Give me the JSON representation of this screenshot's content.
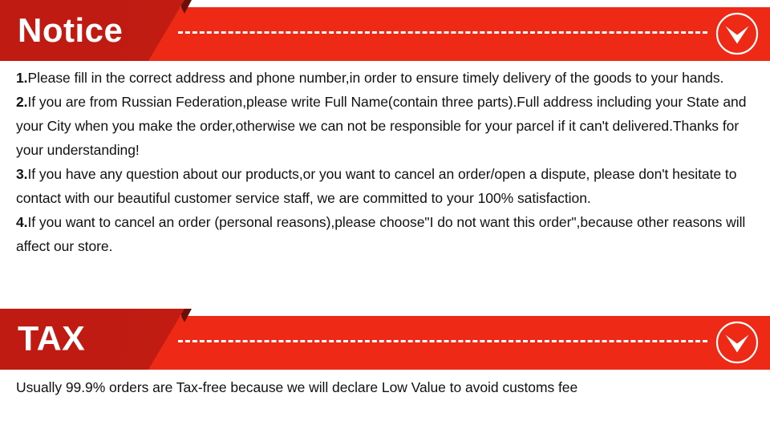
{
  "sections": [
    {
      "id": "notice",
      "title": "Notice",
      "icon": "chevron-down-circle-icon",
      "paragraphs": [
        {
          "number": "1.",
          "text": "Please fill in the correct address and phone number,in order to ensure timely delivery of the goods to your hands."
        },
        {
          "number": "2.",
          "text": "If you are from Russian Federation,please write Full Name(contain three parts).Full address including your State and your City when you make the order,otherwise we can not be responsible for your parcel if it can't delivered.Thanks for your understanding!"
        },
        {
          "number": "3.",
          "text": "If you have any question about our products,or you want to cancel an order/open a dispute, please don't hesitate to contact with our beautiful customer service staff, we are committed to your 100% satisfaction."
        },
        {
          "number": "4.",
          "text": "If you want to cancel an order (personal reasons),please choose\"I do not want this order\",because other reasons will affect our store."
        }
      ]
    },
    {
      "id": "tax",
      "title": "TAX",
      "icon": "chevron-down-circle-icon",
      "paragraphs": [
        {
          "number": "",
          "text": "Usually 99.9% orders are Tax-free because we will declare Low Value to avoid customs fee"
        }
      ]
    }
  ],
  "colors": {
    "banner_bright_red": "#ee2a17",
    "banner_dark_red": "#bf1b12",
    "banner_notch": "#6b1009",
    "banner_text": "#ffffff",
    "body_text": "#111111",
    "background": "#ffffff"
  }
}
